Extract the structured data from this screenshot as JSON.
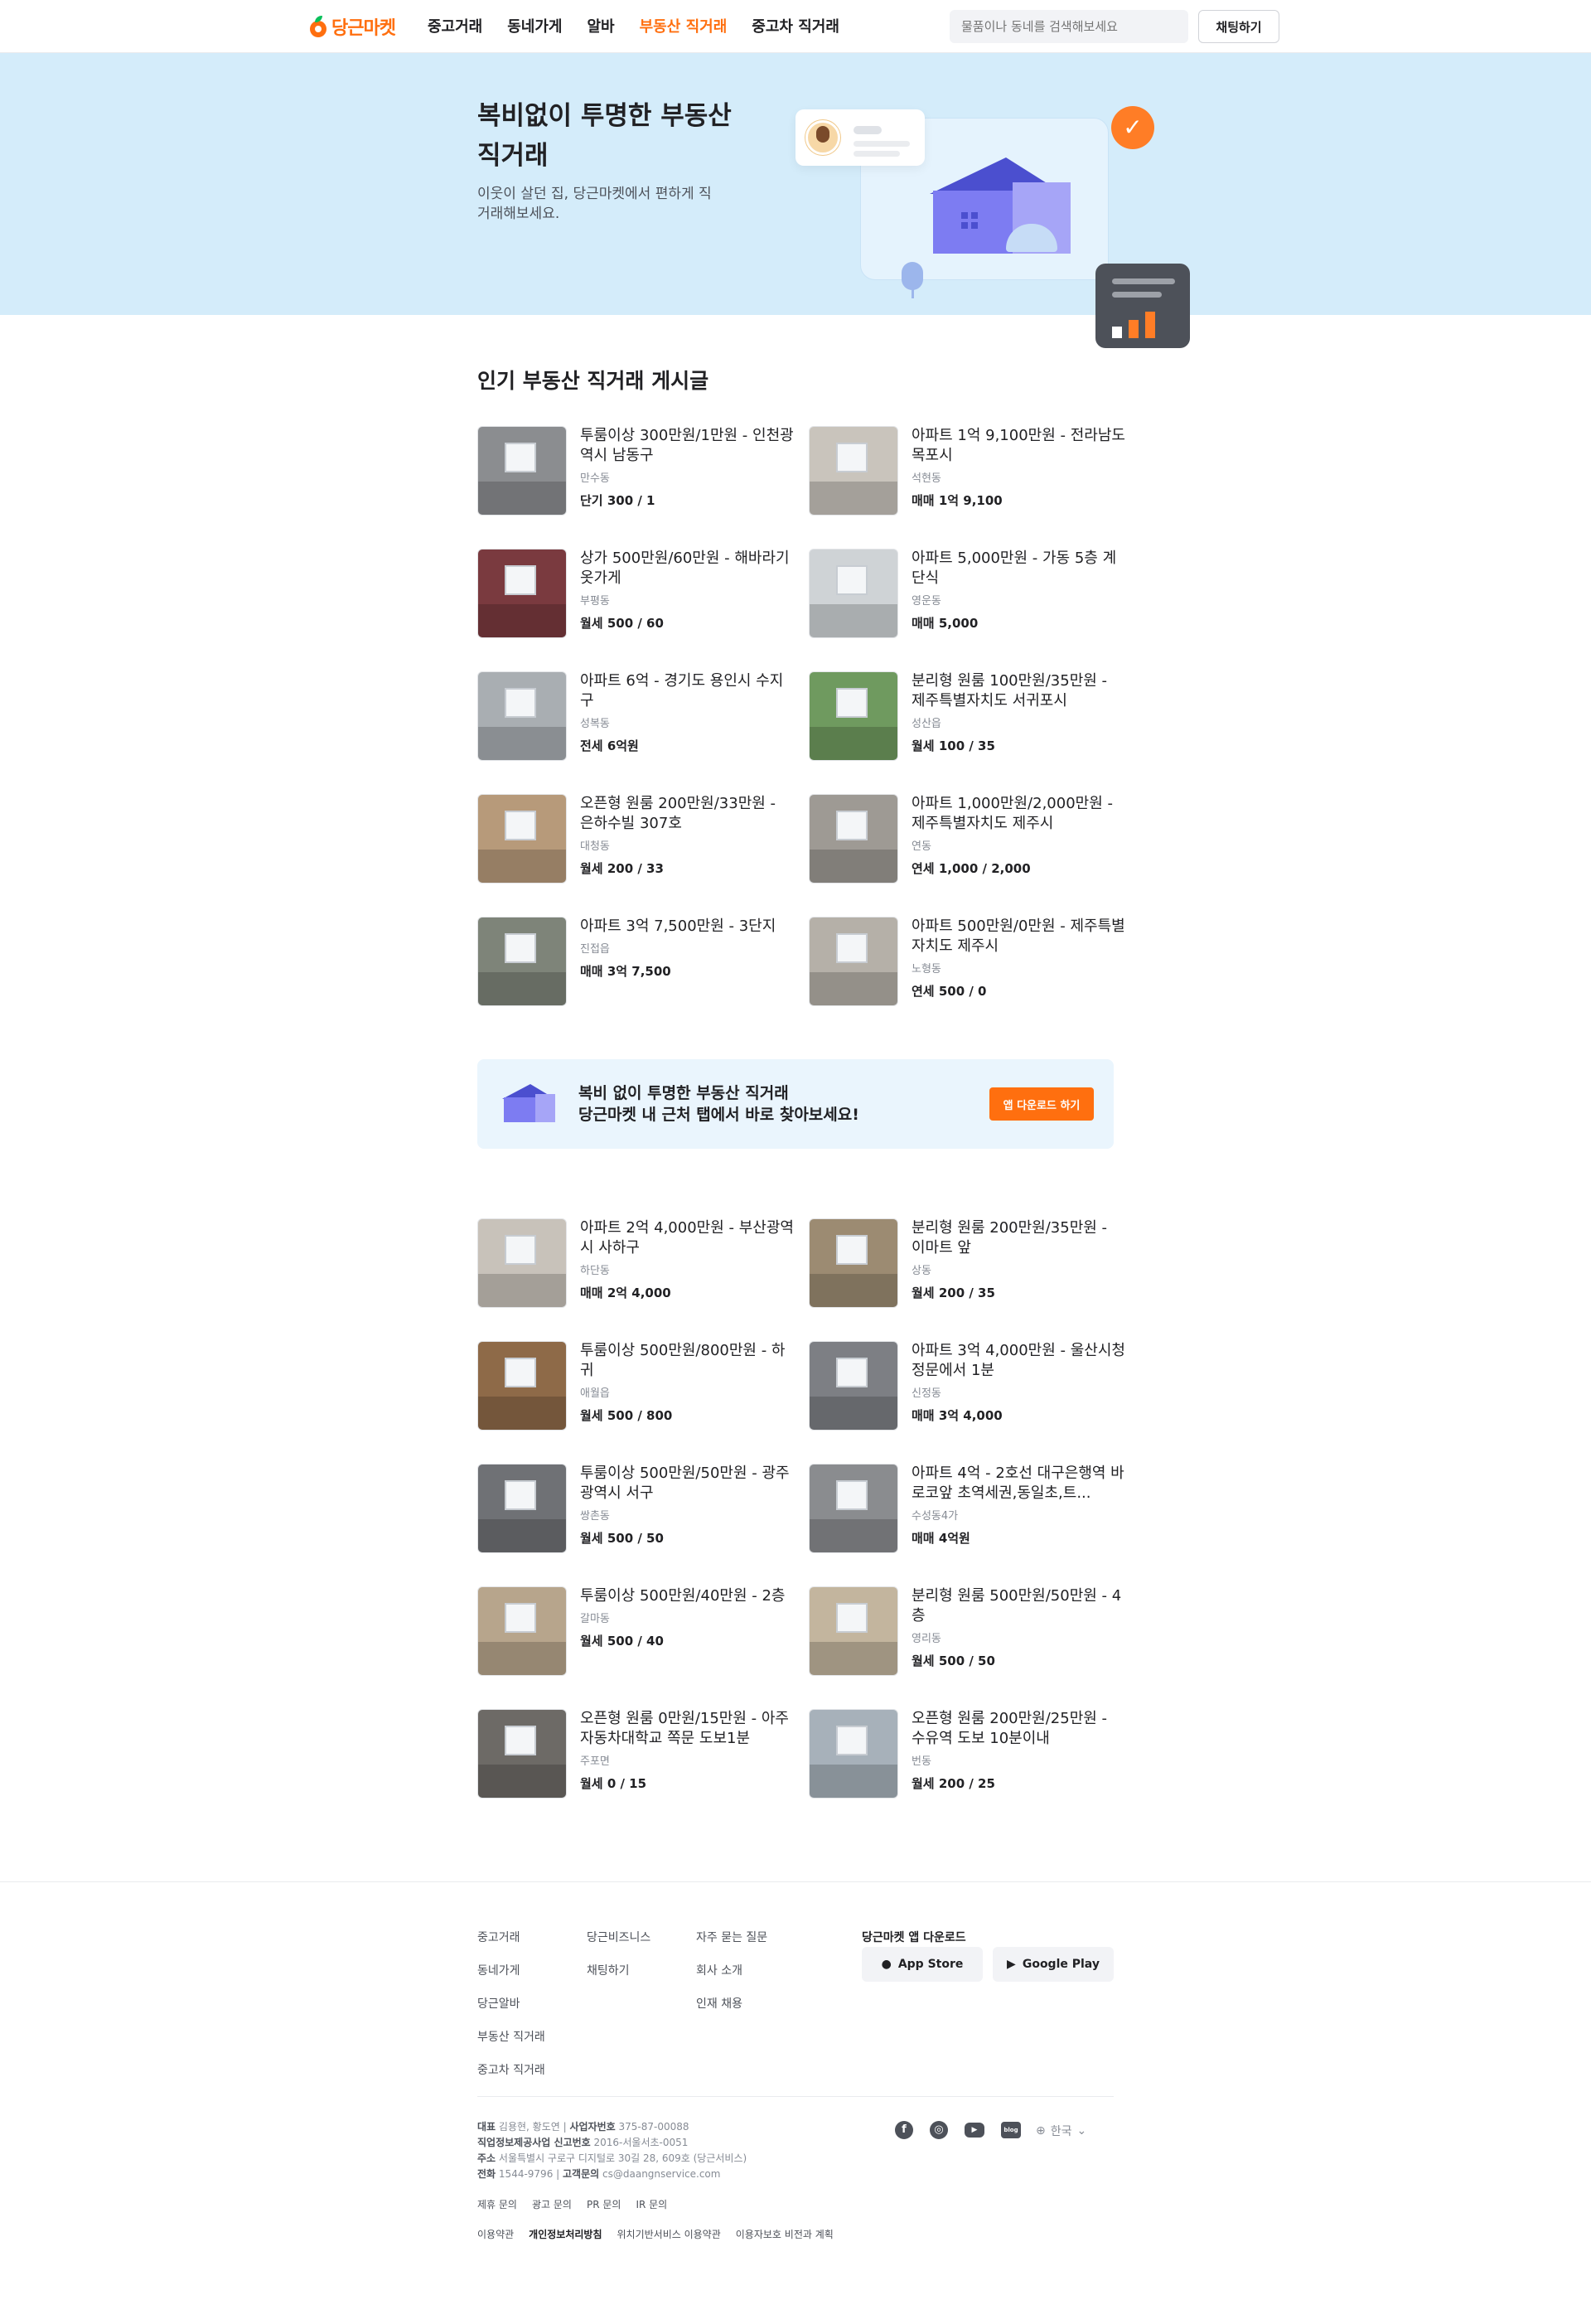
{
  "header": {
    "logo_text": "당근마켓",
    "nav": [
      {
        "label": "중고거래",
        "active": false
      },
      {
        "label": "동네가게",
        "active": false
      },
      {
        "label": "알바",
        "active": false
      },
      {
        "label": "부동산 직거래",
        "active": true
      },
      {
        "label": "중고차 직거래",
        "active": false
      }
    ],
    "search_placeholder": "물품이나 동네를 검색해보세요",
    "chat_button": "채팅하기"
  },
  "hero": {
    "title": "복비없이 투명한 부동산 직거래",
    "subtitle": "이웃이 살던 집, 당근마켓에서 편하게 직거래해보세요."
  },
  "section": {
    "title": "인기 부동산 직거래 게시글"
  },
  "listings_top": [
    {
      "title": "투룸이상 300만원/1만원 - 인천광역시 남동구",
      "location": "만수동",
      "price": "단기 300 / 1",
      "thumb": "#8b8d90"
    },
    {
      "title": "아파트 1억 9,100만원 - 전라남도 목포시",
      "location": "석현동",
      "price": "매매 1억 9,100",
      "thumb": "#c9c4bc"
    },
    {
      "title": "상가 500만원/60만원 - 해바라기 옷가게",
      "location": "부평동",
      "price": "월세 500 / 60",
      "thumb": "#7a3a3f"
    },
    {
      "title": "아파트 5,000만원 - 가동 5층 계단식",
      "location": "영운동",
      "price": "매매 5,000",
      "thumb": "#cfd3d6"
    },
    {
      "title": "아파트 6억 - 경기도 용인시 수지구",
      "location": "성복동",
      "price": "전세 6억원",
      "thumb": "#a9aeb2"
    },
    {
      "title": "분리형 원룸 100만원/35만원 - 제주특별자치도 서귀포시",
      "location": "성산읍",
      "price": "월세 100 / 35",
      "thumb": "#6f9a5f"
    },
    {
      "title": "오픈형 원룸 200만원/33만원 - 은하수빌 307호",
      "location": "대청동",
      "price": "월세 200 / 33",
      "thumb": "#b79a7a"
    },
    {
      "title": "아파트 1,000만원/2,000만원 - 제주특별자치도 제주시",
      "location": "연동",
      "price": "연세 1,000 / 2,000",
      "thumb": "#9e9a94"
    },
    {
      "title": "아파트 3억 7,500만원 - 3단지",
      "location": "진접읍",
      "price": "매매 3억 7,500",
      "thumb": "#7e8479"
    },
    {
      "title": "아파트 500만원/0만원 - 제주특별자치도 제주시",
      "location": "노형동",
      "price": "연세 500 / 0",
      "thumb": "#b5b0a8"
    }
  ],
  "banner": {
    "line1": "복비 없이 투명한 부동산 직거래",
    "line2": "당근마켓 내 근처 탭에서 바로 찾아보세요!",
    "button": "앱 다운로드 하기"
  },
  "listings_bottom": [
    {
      "title": "아파트 2억 4,000만원 - 부산광역시 사하구",
      "location": "하단동",
      "price": "매매 2억 4,000",
      "thumb": "#c8c2ba"
    },
    {
      "title": "분리형 원룸 200만원/35만원 - 이마트 앞",
      "location": "상동",
      "price": "월세 200 / 35",
      "thumb": "#9c8b72"
    },
    {
      "title": "투룸이상 500만원/800만원 - 하귀",
      "location": "애월읍",
      "price": "월세 500 / 800",
      "thumb": "#8e6a48"
    },
    {
      "title": "아파트 3억 4,000만원 - 울산시청 정문에서 1분",
      "location": "신정동",
      "price": "매매 3억 4,000",
      "thumb": "#7d7f84"
    },
    {
      "title": "투룸이상 500만원/50만원 - 광주광역시 서구",
      "location": "쌍촌동",
      "price": "월세 500 / 50",
      "thumb": "#6f7175"
    },
    {
      "title": "아파트 4억 - 2호선 대구은행역 바로코앞 초역세권,동일초,트...",
      "location": "수성동4가",
      "price": "매매 4억원",
      "thumb": "#8a8c8f"
    },
    {
      "title": "투룸이상 500만원/40만원 - 2층",
      "location": "갈마동",
      "price": "월세 500 / 40",
      "thumb": "#b7a58c"
    },
    {
      "title": "분리형 원룸 500만원/50만원 - 4층",
      "location": "영리동",
      "price": "월세 500 / 50",
      "thumb": "#c3b59e"
    },
    {
      "title": "오픈형 원룸 0만원/15만원 - 아주자동차대학교 쪽문 도보1분",
      "location": "주포면",
      "price": "월세 0 / 15",
      "thumb": "#6d6a66"
    },
    {
      "title": "오픈형 원룸 200만원/25만원 - 수유역 도보 10분이내",
      "location": "번동",
      "price": "월세 200 / 25",
      "thumb": "#a7b1ba"
    }
  ],
  "footer": {
    "col1": [
      "중고거래",
      "동네가게",
      "당근알바",
      "부동산 직거래",
      "중고차 직거래"
    ],
    "col2": [
      "당근비즈니스",
      "채팅하기"
    ],
    "col3": [
      "자주 묻는 질문",
      "회사 소개",
      "인재 채용"
    ],
    "download_title": "당근마켓 앱 다운로드",
    "app_store": "App Store",
    "google_play": "Google Play",
    "info": {
      "ceo_label": "대표",
      "ceo": "김용현, 황도연",
      "biz_label": "사업자번호",
      "biz": "375-87-00088",
      "telecom_label": "직업정보제공사업 신고번호",
      "telecom": "2016-서울서초-0051",
      "addr_label": "주소",
      "addr": "서울특별시 구로구 디지털로 30길 28, 609호 (당근서비스)",
      "tel_label": "전화",
      "tel": "1544-9796",
      "mail_label": "고객문의",
      "mail": "cs@daangnservice.com"
    },
    "links1": [
      "제휴 문의",
      "광고 문의",
      "PR 문의",
      "IR 문의"
    ],
    "links2": [
      "이용약관",
      "개인정보처리방침",
      "위치기반서비스 이용약관",
      "이용자보호 비전과 계획"
    ],
    "language": "한국"
  }
}
